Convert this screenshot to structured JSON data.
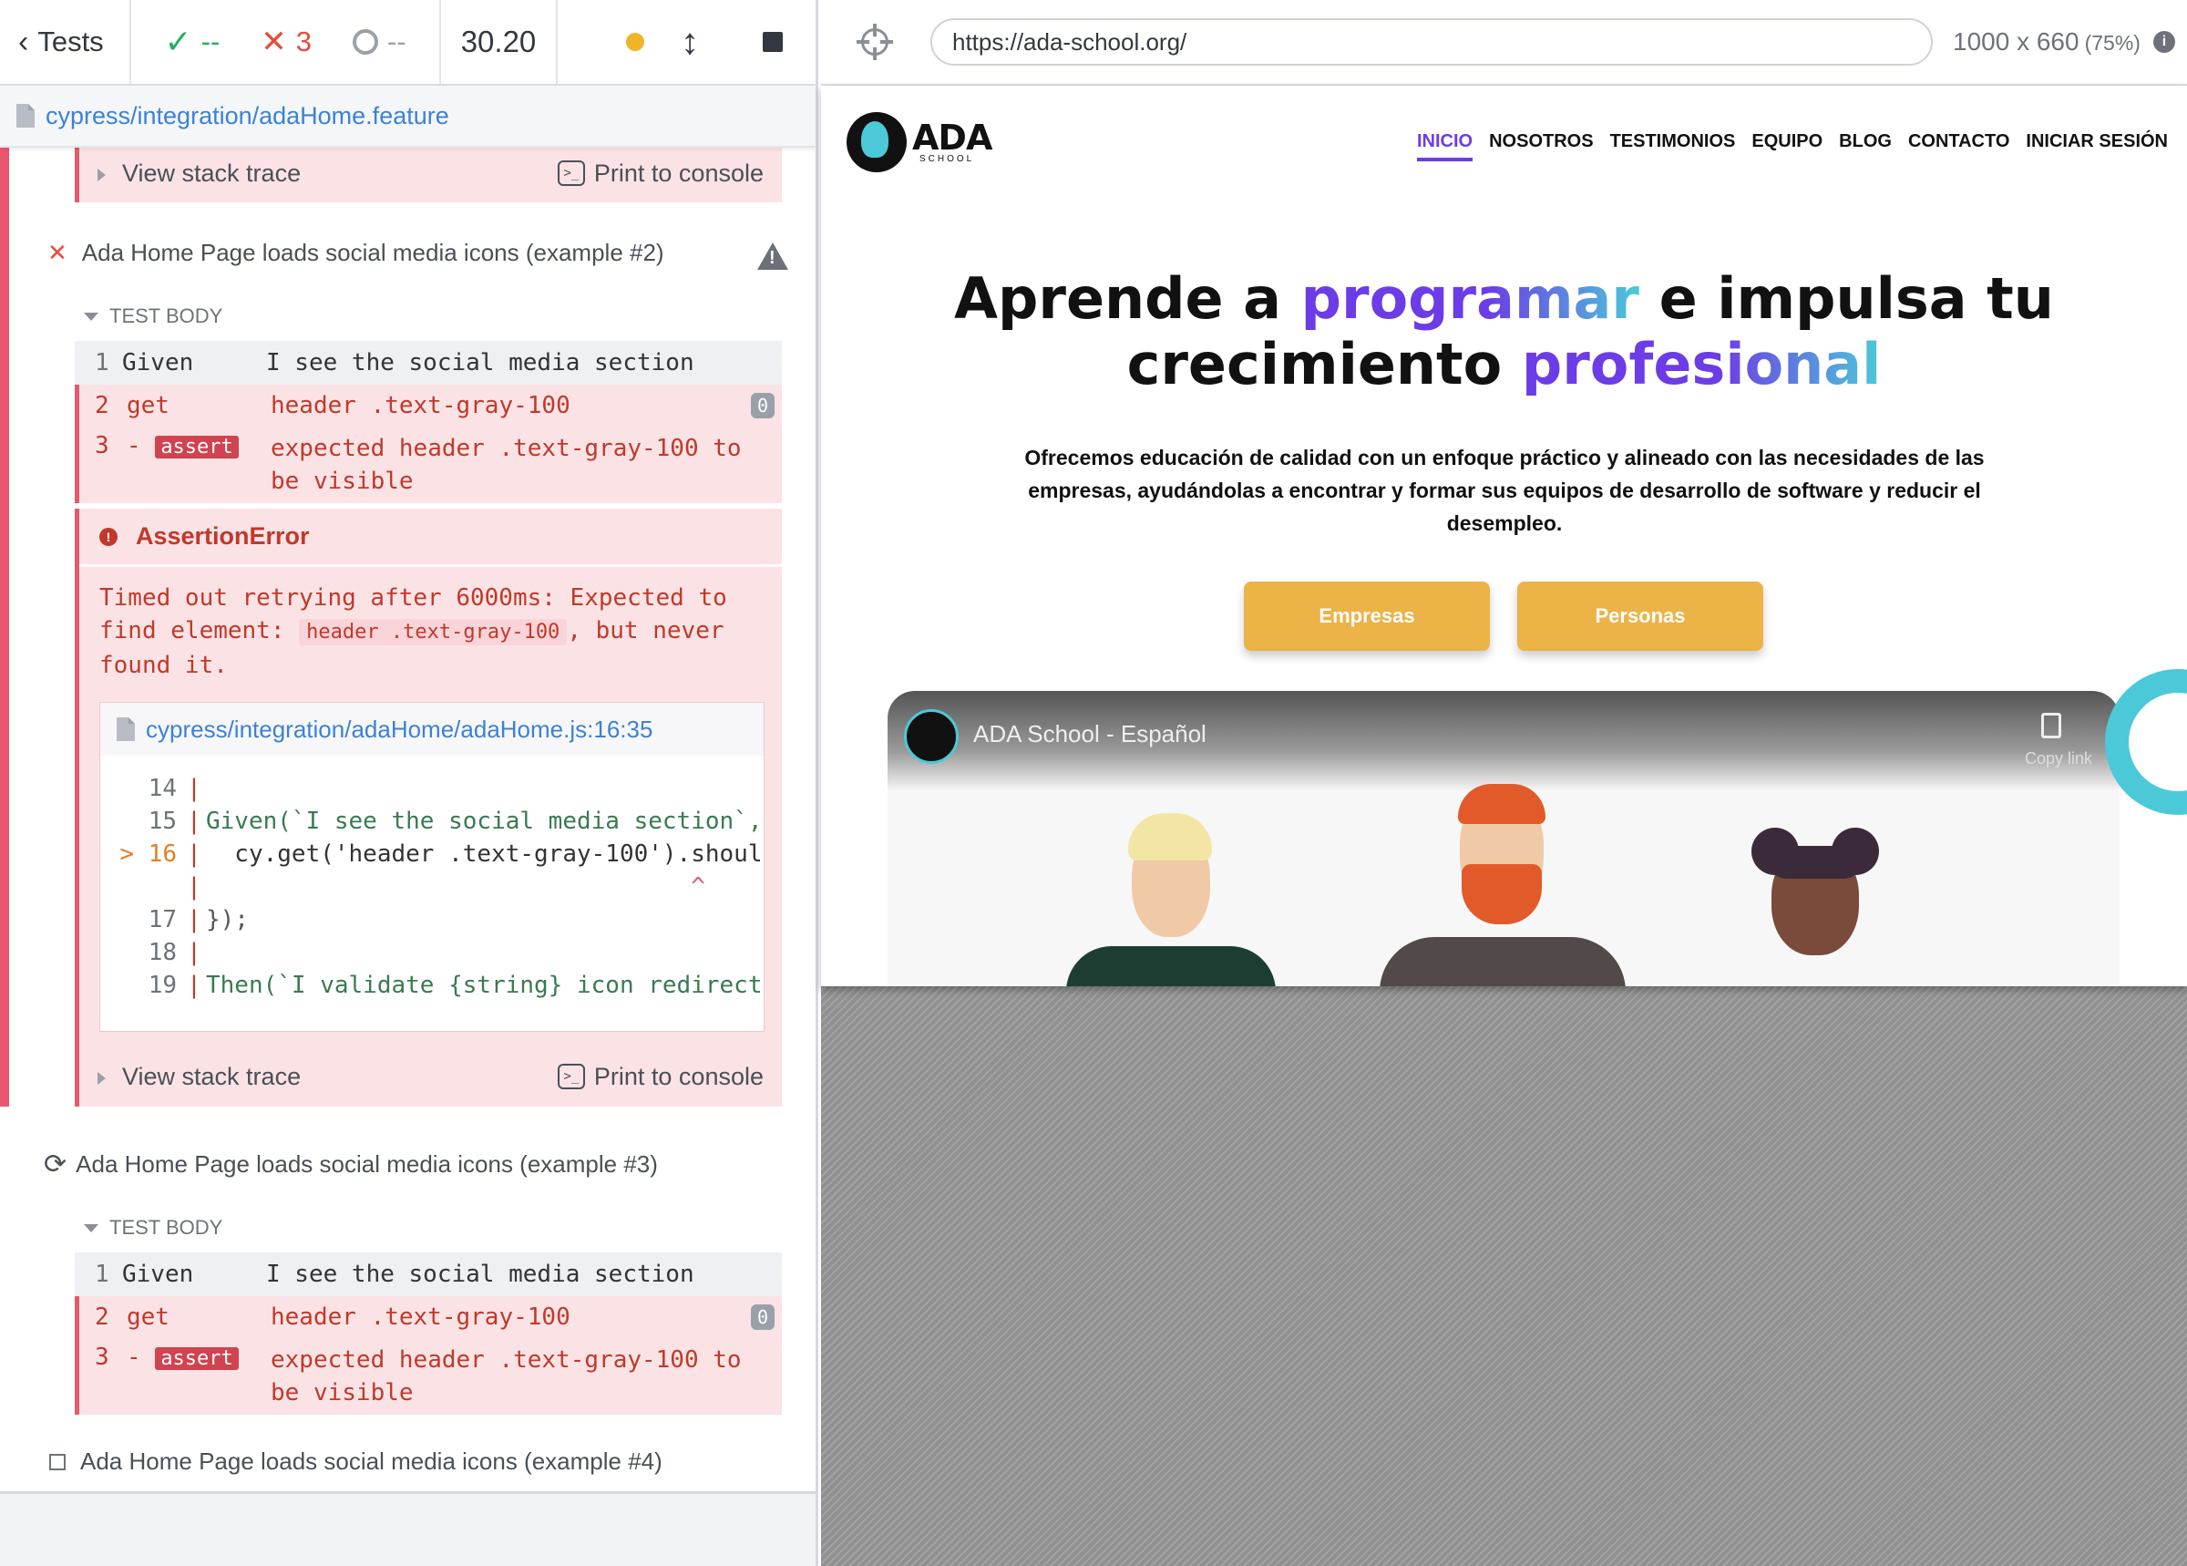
{
  "reporter": {
    "tests_label": "Tests",
    "passed": "--",
    "failed": "3",
    "pending": "--",
    "duration": "30.20",
    "spec_path": "cypress/integration/adaHome.feature",
    "view_stack_trace": "View stack trace",
    "print_to_console": "Print to console",
    "test2": {
      "title": "Ada Home Page loads social media icons (example #2)",
      "body_label": "TEST BODY",
      "commands": [
        {
          "num": "1",
          "name": "Given",
          "msg": "I see the social media section"
        },
        {
          "num": "2",
          "name": "get",
          "msg": "header .text-gray-100",
          "badge": "0"
        },
        {
          "num": "3",
          "name": "assert",
          "msg_pre": "expected",
          "msg_code": "header .text-gray-100",
          "msg_post": "to be visible"
        }
      ],
      "error": {
        "name": "AssertionError",
        "msg_pre": "Timed out retrying after 6000ms: Expected to find element:",
        "msg_code": "header .text-gray-100",
        "msg_post": ", but never found it.",
        "file": "cypress/integration/adaHome/adaHome.js:16:35",
        "lines": [
          {
            "ln": "14",
            "src": ""
          },
          {
            "ln": "15",
            "src": "Given(`I see the social media section`,"
          },
          {
            "ln": "16",
            "src": "  cy.get('header .text-gray-100').shoul",
            "hl": true
          },
          {
            "ln": "",
            "src": "                                  ^"
          },
          {
            "ln": "17",
            "src": "});"
          },
          {
            "ln": "18",
            "src": ""
          },
          {
            "ln": "19",
            "src": "Then(`I validate {string} icon redirect"
          }
        ]
      }
    },
    "test3": {
      "title": "Ada Home Page loads social media icons (example #3)",
      "body_label": "TEST BODY",
      "commands": [
        {
          "num": "1",
          "name": "Given",
          "msg": "I see the social media section"
        },
        {
          "num": "2",
          "name": "get",
          "msg": "header .text-gray-100",
          "badge": "0"
        },
        {
          "num": "3",
          "name": "assert",
          "msg_pre": "expected",
          "msg_code": "header .text-gray-100",
          "msg_post": "to be visible"
        }
      ]
    },
    "test4": {
      "title": "Ada Home Page loads social media icons (example #4)"
    }
  },
  "aut": {
    "url": "https://ada-school.org/",
    "viewport": "1000 x 660",
    "scale": "(75%)",
    "site": {
      "logo_text": "ADA",
      "logo_sub": "SCHOOL",
      "nav": [
        "INICIO",
        "NOSOTROS",
        "TESTIMONIOS",
        "EQUIPO",
        "BLOG",
        "CONTACTO",
        "INICIAR SESIÓN"
      ],
      "hero": {
        "w1": "Aprende a",
        "w2": "programar",
        "w3": "e impulsa tu",
        "w4": "crecimiento",
        "w5": "profesional"
      },
      "description": "Ofrecemos educación de calidad con un enfoque práctico y alineado con las necesidades de las empresas, ayudándolas a encontrar y formar sus equipos de desarrollo de software y reducir el desempleo.",
      "btn_empresas": "Empresas",
      "btn_personas": "Personas",
      "video_title": "ADA School - Español",
      "copy_link": "Copy link"
    }
  },
  "colors": {
    "fail": "#e74c3c",
    "pass": "#27ae60",
    "accent": "#6c3ce6",
    "cyan": "#4cc9d8",
    "button": "#ecb347"
  }
}
